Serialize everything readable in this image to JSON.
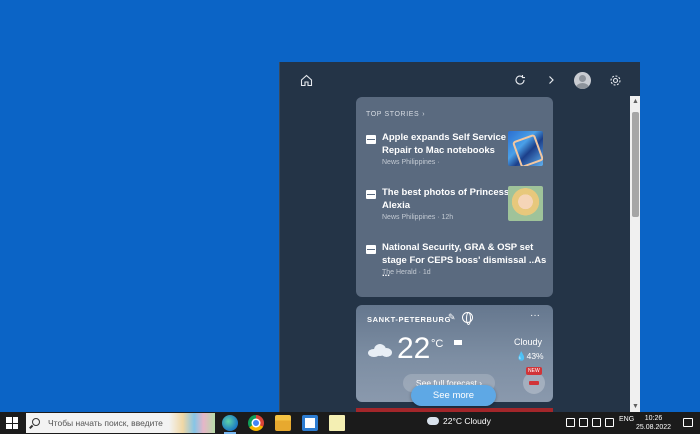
{
  "panel": {
    "top_stories": {
      "header": "TOP STORIES",
      "items": [
        {
          "title": "Apple expands Self Service Repair to Mac notebooks",
          "meta": "News Philippines ·"
        },
        {
          "title": "The best photos of Princess Alexia",
          "meta": "News Philippines · 12h"
        },
        {
          "title": "National Security, GRA & OSP set stage For CEPS boss' dismissal ..As ...",
          "meta": "The Herald · 1d"
        }
      ]
    },
    "weather": {
      "city": "SANKT-PETERBURG",
      "more": "···",
      "temp": "22",
      "unit": "°C",
      "condition": "Cloudy",
      "humidity": "43%",
      "forecast_link": "See full forecast",
      "new_badge": "NEW"
    },
    "see_more": "See more"
  },
  "taskbar": {
    "search_placeholder": "Чтобы начать поиск, введите",
    "weather": "22°C  Cloudy",
    "lang": "ENG",
    "time": "10:26",
    "date": "25.08.2022"
  }
}
